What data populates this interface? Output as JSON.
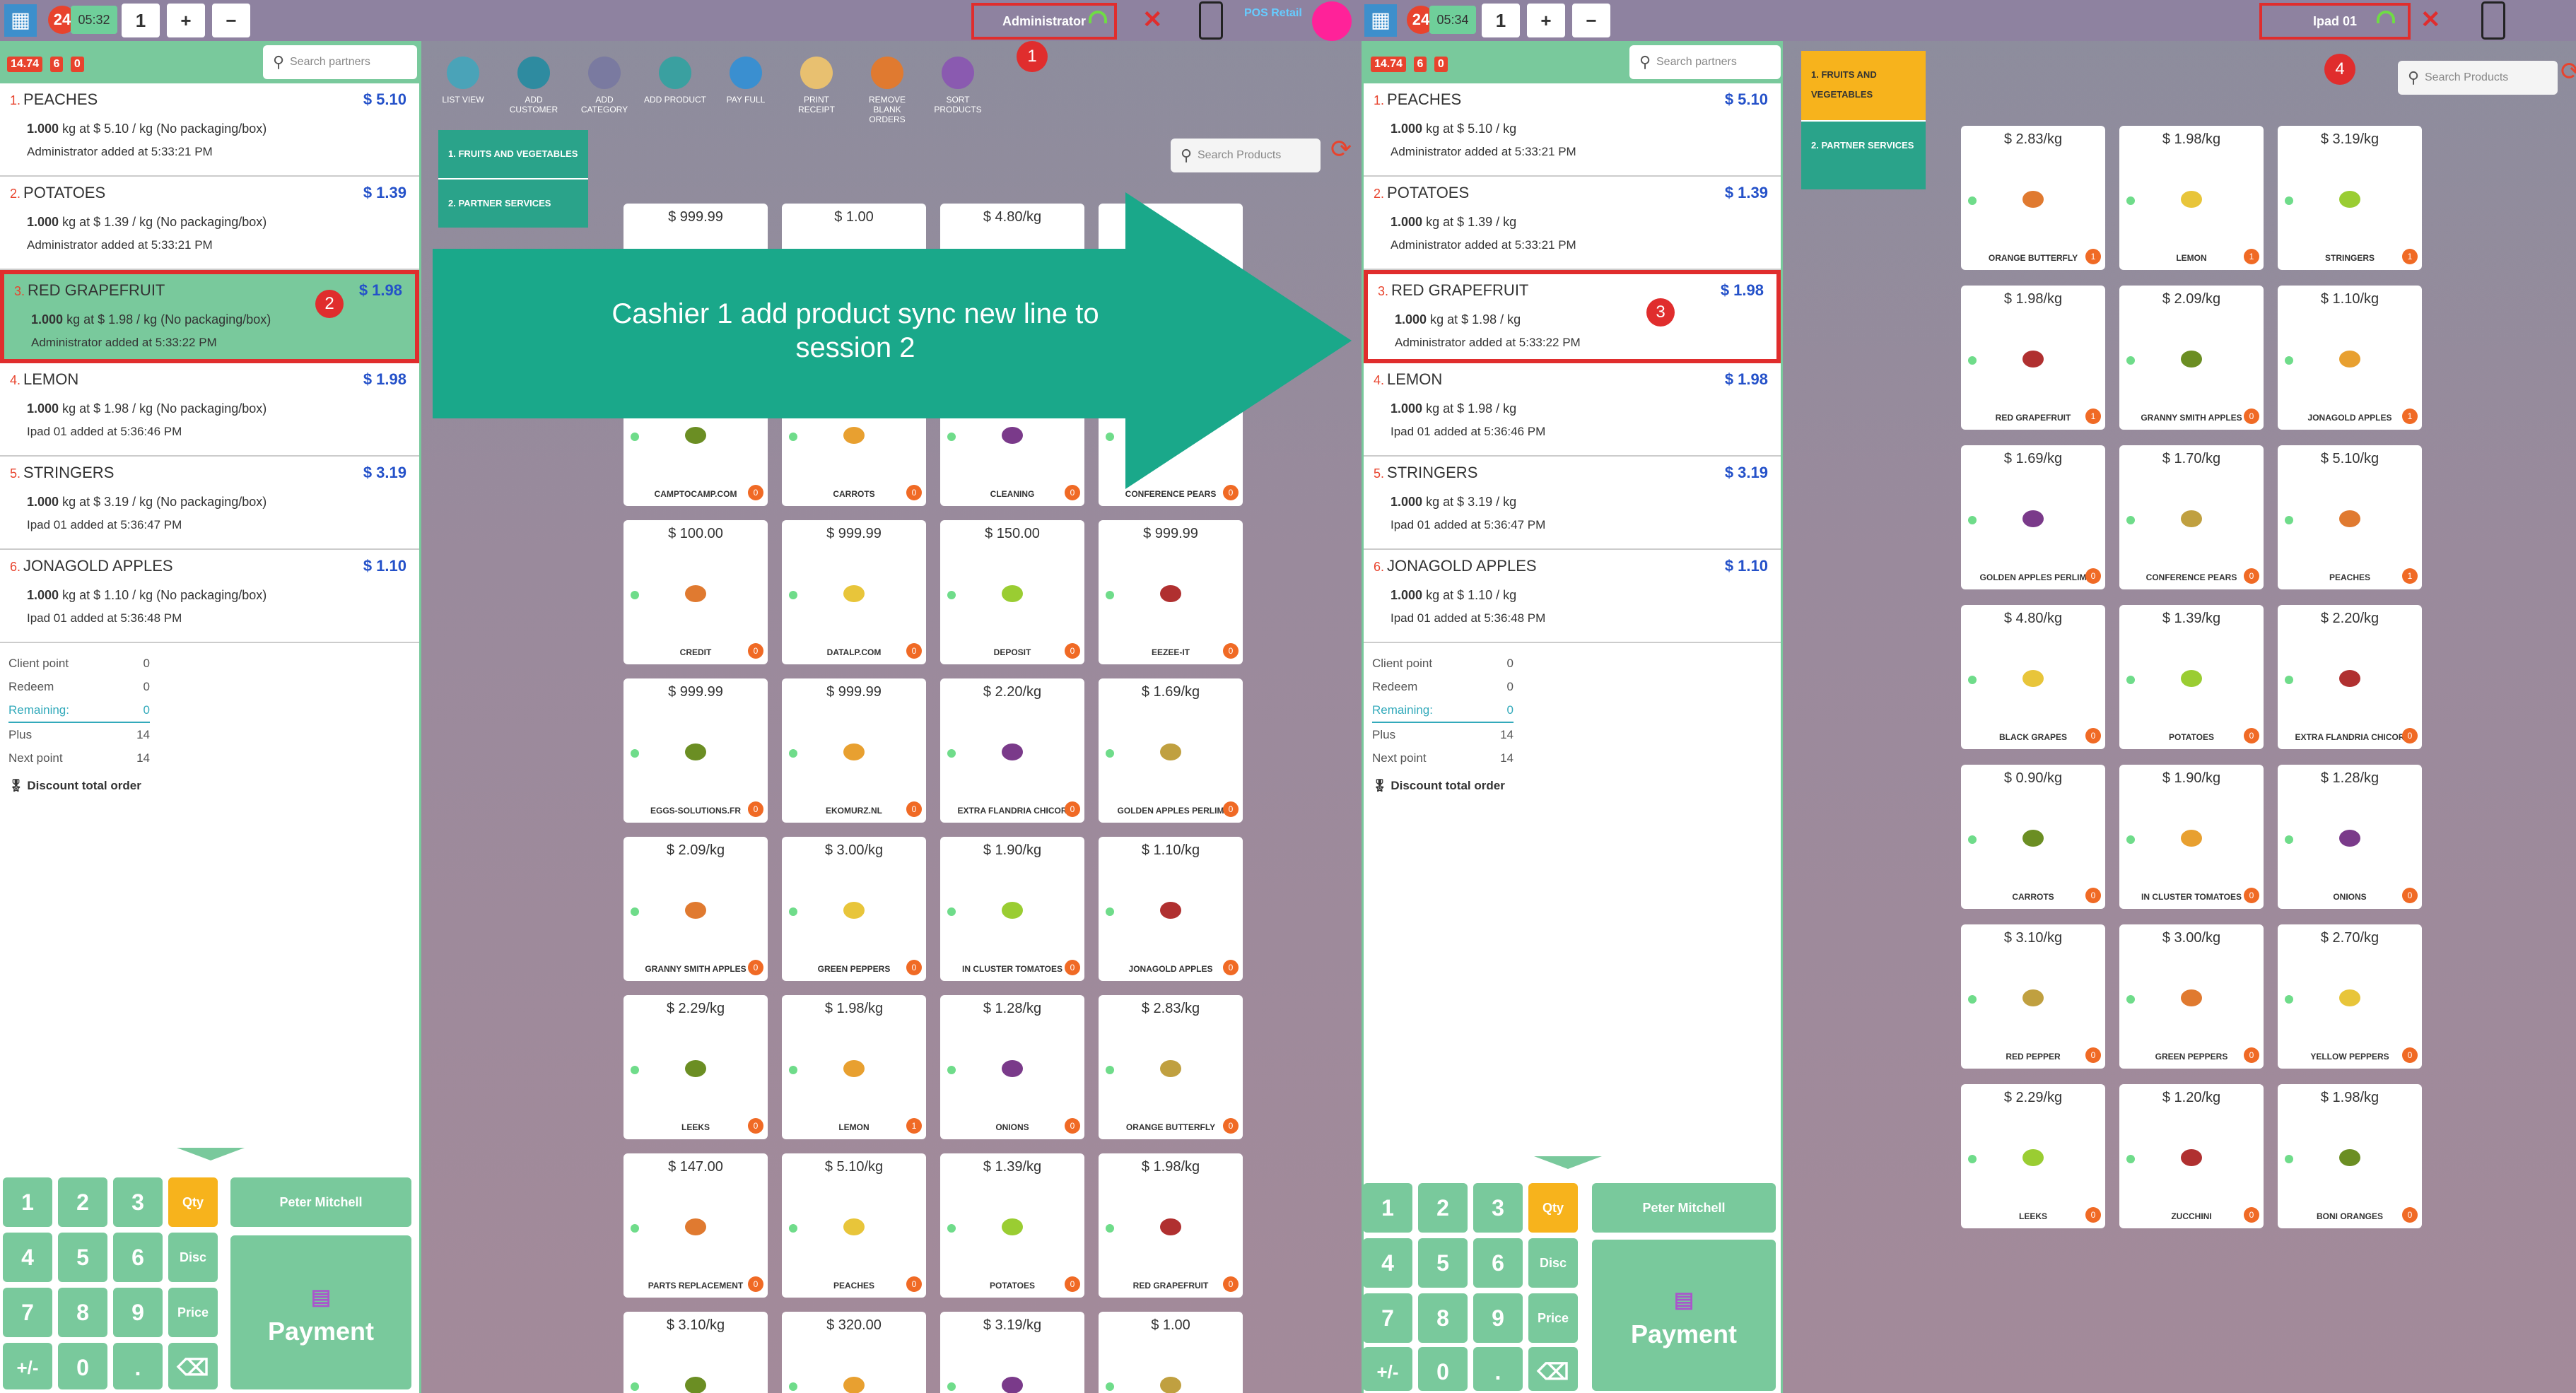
{
  "session1": {
    "time": "05:32",
    "orders_badge": "24",
    "tabs": [
      "1",
      "+",
      "−"
    ],
    "user": "Administrator",
    "brand": "POS Retail",
    "stats": [
      "14.74",
      "6",
      "0"
    ],
    "search_partners": "Search partners",
    "search_products": "Search Products",
    "toolbar": [
      "LIST VIEW",
      "ADD CUSTOMER",
      "ADD CATEGORY",
      "ADD PRODUCT",
      "PAY FULL",
      "PRINT RECEIPT",
      "REMOVE BLANK ORDERS",
      "SORT PRODUCTS"
    ],
    "categories": [
      {
        "idx": "1.",
        "name": "FRUITS AND VEGETABLES"
      },
      {
        "idx": "2.",
        "name": "PARTNER SERVICES"
      }
    ],
    "lines": [
      {
        "idx": "1.",
        "name": "PEACHES",
        "price": "$ 5.10",
        "qty": "1.000",
        "detail": "kg at $ 5.10 / kg (No packaging/box)",
        "by": "Administrator added at 5:33:21 PM"
      },
      {
        "idx": "2.",
        "name": "POTATOES",
        "price": "$ 1.39",
        "qty": "1.000",
        "detail": "kg at $ 1.39 / kg (No packaging/box)",
        "by": "Administrator added at 5:33:21 PM"
      },
      {
        "idx": "3.",
        "name": "RED GRAPEFRUIT",
        "price": "$ 1.98",
        "qty": "1.000",
        "detail": "kg at $ 1.98 / kg (No packaging/box)",
        "by": "Administrator added at 5:33:22 PM"
      },
      {
        "idx": "4.",
        "name": "LEMON",
        "price": "$ 1.98",
        "qty": "1.000",
        "detail": "kg at $ 1.98 / kg (No packaging/box)",
        "by": "Ipad 01 added at 5:36:46 PM"
      },
      {
        "idx": "5.",
        "name": "STRINGERS",
        "price": "$ 3.19",
        "qty": "1.000",
        "detail": "kg at $ 3.19 / kg (No packaging/box)",
        "by": "Ipad 01 added at 5:36:47 PM"
      },
      {
        "idx": "6.",
        "name": "JONAGOLD APPLES",
        "price": "$ 1.10",
        "qty": "1.000",
        "detail": "kg at $ 1.10 / kg (No packaging/box)",
        "by": "Ipad 01 added at 5:36:48 PM"
      }
    ],
    "loyalty": [
      {
        "label": "Client point",
        "value": "0"
      },
      {
        "label": "Redeem",
        "value": "0"
      },
      {
        "label": "Remaining:",
        "value": "0"
      },
      {
        "label": "Plus",
        "value": "14"
      },
      {
        "label": "Next point",
        "value": "14"
      }
    ],
    "discount_label": "Discount total order",
    "customer": "Peter Mitchell",
    "payment": "Payment",
    "products": [
      {
        "price": "$ 999.99",
        "name": ""
      },
      {
        "price": "$ 1.00",
        "name": ""
      },
      {
        "price": "$ 4.80/kg",
        "name": ""
      },
      {
        "price": "",
        "name": ""
      },
      {
        "price": "",
        "name": "CAMPTOCAMP.COM"
      },
      {
        "price": "",
        "name": "CARROTS"
      },
      {
        "price": "",
        "name": "CLEANING"
      },
      {
        "price": "",
        "name": "CONFERENCE PEARS"
      },
      {
        "price": "$ 100.00",
        "name": "CREDIT"
      },
      {
        "price": "$ 999.99",
        "name": "DATALP.COM"
      },
      {
        "price": "$ 150.00",
        "name": "DEPOSIT"
      },
      {
        "price": "$ 999.99",
        "name": "EEZEE-IT"
      },
      {
        "price": "$ 999.99",
        "name": "EGGS-SOLUTIONS.FR"
      },
      {
        "price": "$ 999.99",
        "name": "EKOMURZ.NL"
      },
      {
        "price": "$ 2.20/kg",
        "name": "EXTRA FLANDRIA CHICOR"
      },
      {
        "price": "$ 1.69/kg",
        "name": "GOLDEN APPLES PERLIM"
      },
      {
        "price": "$ 2.09/kg",
        "name": "GRANNY SMITH APPLES"
      },
      {
        "price": "$ 3.00/kg",
        "name": "GREEN PEPPERS"
      },
      {
        "price": "$ 1.90/kg",
        "name": "IN CLUSTER TOMATOES"
      },
      {
        "price": "$ 1.10/kg",
        "name": "JONAGOLD APPLES"
      },
      {
        "price": "$ 2.29/kg",
        "name": "LEEKS"
      },
      {
        "price": "$ 1.98/kg",
        "name": "LEMON"
      },
      {
        "price": "$ 1.28/kg",
        "name": "ONIONS"
      },
      {
        "price": "$ 2.83/kg",
        "name": "ORANGE BUTTERFLY"
      },
      {
        "price": "$ 147.00",
        "name": "PARTS REPLACEMENT"
      },
      {
        "price": "$ 5.10/kg",
        "name": "PEACHES"
      },
      {
        "price": "$ 1.39/kg",
        "name": "POTATOES"
      },
      {
        "price": "$ 1.98/kg",
        "name": "RED GRAPEFRUIT"
      },
      {
        "price": "$ 3.10/kg",
        "name": ""
      },
      {
        "price": "$ 320.00",
        "name": ""
      },
      {
        "price": "$ 3.19/kg",
        "name": ""
      },
      {
        "price": "$ 1.00",
        "name": ""
      }
    ],
    "product_counts": [
      "",
      "",
      "",
      "",
      "0",
      "0",
      "0",
      "0",
      "0",
      "0",
      "0",
      "0",
      "0",
      "0",
      "0",
      "0",
      "0",
      "0",
      "0",
      "0",
      "0",
      "1",
      "0",
      "0",
      "0",
      "0",
      "0",
      "0",
      "",
      "",
      "",
      ""
    ]
  },
  "session2": {
    "time": "05:34",
    "orders_badge": "24",
    "tabs": [
      "1",
      "+",
      "−"
    ],
    "user": "Ipad 01",
    "stats": [
      "14.74",
      "6",
      "0"
    ],
    "search_partners": "Search partners",
    "search_products": "Search Products",
    "categories": [
      {
        "idx": "1.",
        "name": "FRUITS AND VEGETABLES"
      },
      {
        "idx": "2.",
        "name": "PARTNER SERVICES"
      }
    ],
    "lines": [
      {
        "idx": "1.",
        "name": "PEACHES",
        "price": "$ 5.10",
        "qty": "1.000",
        "detail": "kg at $ 5.10 / kg",
        "by": "Administrator added at 5:33:21 PM"
      },
      {
        "idx": "2.",
        "name": "POTATOES",
        "price": "$ 1.39",
        "qty": "1.000",
        "detail": "kg at $ 1.39 / kg",
        "by": "Administrator added at 5:33:21 PM"
      },
      {
        "idx": "3.",
        "name": "RED GRAPEFRUIT",
        "price": "$ 1.98",
        "qty": "1.000",
        "detail": "kg at $ 1.98 / kg",
        "by": "Administrator added at 5:33:22 PM"
      },
      {
        "idx": "4.",
        "name": "LEMON",
        "price": "$ 1.98",
        "qty": "1.000",
        "detail": "kg at $ 1.98 / kg",
        "by": "Ipad 01 added at 5:36:46 PM"
      },
      {
        "idx": "5.",
        "name": "STRINGERS",
        "price": "$ 3.19",
        "qty": "1.000",
        "detail": "kg at $ 3.19 / kg",
        "by": "Ipad 01 added at 5:36:47 PM"
      },
      {
        "idx": "6.",
        "name": "JONAGOLD APPLES",
        "price": "$ 1.10",
        "qty": "1.000",
        "detail": "kg at $ 1.10 / kg",
        "by": "Ipad 01 added at 5:36:48 PM"
      }
    ],
    "loyalty": [
      {
        "label": "Client point",
        "value": "0"
      },
      {
        "label": "Redeem",
        "value": "0"
      },
      {
        "label": "Remaining:",
        "value": "0"
      },
      {
        "label": "Plus",
        "value": "14"
      },
      {
        "label": "Next point",
        "value": "14"
      }
    ],
    "discount_label": "Discount total order",
    "customer": "Peter Mitchell",
    "payment": "Payment",
    "products": [
      {
        "price": "$ 2.83/kg",
        "name": "ORANGE BUTTERFLY"
      },
      {
        "price": "$ 1.98/kg",
        "name": "LEMON"
      },
      {
        "price": "$ 3.19/kg",
        "name": "STRINGERS"
      },
      {
        "price": "$ 1.98/kg",
        "name": "RED GRAPEFRUIT"
      },
      {
        "price": "$ 2.09/kg",
        "name": "GRANNY SMITH APPLES"
      },
      {
        "price": "$ 1.10/kg",
        "name": "JONAGOLD APPLES"
      },
      {
        "price": "$ 1.69/kg",
        "name": "GOLDEN APPLES PERLIM"
      },
      {
        "price": "$ 1.70/kg",
        "name": "CONFERENCE PEARS"
      },
      {
        "price": "$ 5.10/kg",
        "name": "PEACHES"
      },
      {
        "price": "$ 4.80/kg",
        "name": "BLACK GRAPES"
      },
      {
        "price": "$ 1.39/kg",
        "name": "POTATOES"
      },
      {
        "price": "$ 2.20/kg",
        "name": "EXTRA FLANDRIA CHICOR"
      },
      {
        "price": "$ 0.90/kg",
        "name": "CARROTS"
      },
      {
        "price": "$ 1.90/kg",
        "name": "IN CLUSTER TOMATOES"
      },
      {
        "price": "$ 1.28/kg",
        "name": "ONIONS"
      },
      {
        "price": "$ 3.10/kg",
        "name": "RED PEPPER"
      },
      {
        "price": "$ 3.00/kg",
        "name": "GREEN PEPPERS"
      },
      {
        "price": "$ 2.70/kg",
        "name": "YELLOW PEPPERS"
      },
      {
        "price": "$ 2.29/kg",
        "name": "LEEKS"
      },
      {
        "price": "$ 1.20/kg",
        "name": "ZUCCHINI"
      },
      {
        "price": "$ 1.98/kg",
        "name": "BONI ORANGES"
      }
    ],
    "product_counts": [
      "1",
      "1",
      "1",
      "1",
      "0",
      "1",
      "0",
      "0",
      "1",
      "0",
      "0",
      "0",
      "0",
      "0",
      "0",
      "0",
      "0",
      "0",
      "0",
      "0",
      "0"
    ]
  },
  "annotation": {
    "text": "Cashier 1 add product sync new line to session 2",
    "markers": [
      "1",
      "2",
      "3",
      "4"
    ],
    "arrow_color": "#1aa88a"
  }
}
